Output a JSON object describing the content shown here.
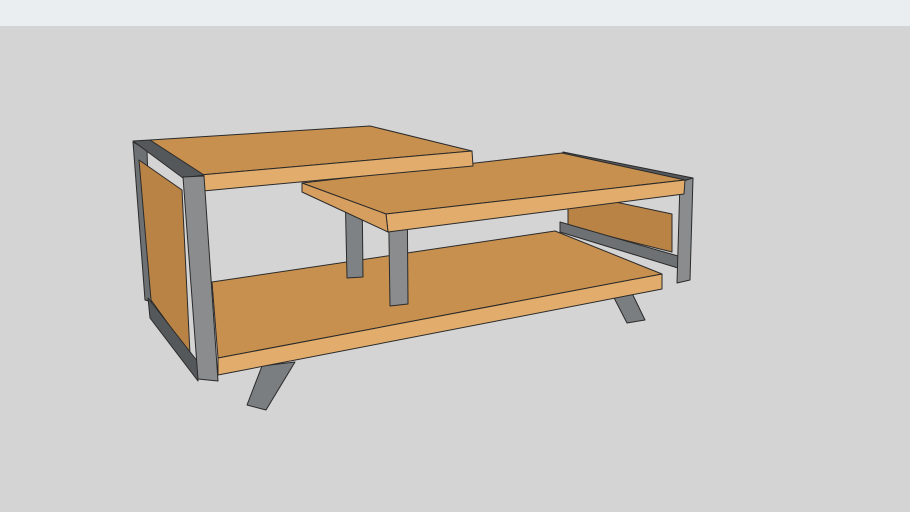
{
  "scene": {
    "subject": "tv-stand-3d-model",
    "colors": {
      "sky": "#eaeef0",
      "ground": "#d4d4d4",
      "wood_top": "#c8904f",
      "wood_edge": "#e2ad6c",
      "wood_panel": "#b98345",
      "steel_light": "#8a8c8e",
      "steel_dark": "#55585a"
    }
  }
}
